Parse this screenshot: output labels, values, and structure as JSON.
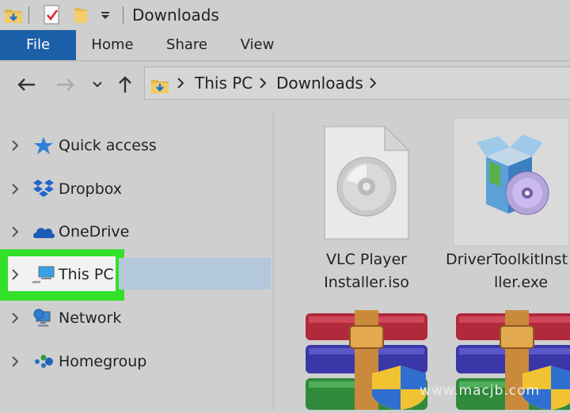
{
  "window": {
    "title": "Downloads"
  },
  "ribbon": {
    "tabs": [
      {
        "label": "File",
        "active": true
      },
      {
        "label": "Home"
      },
      {
        "label": "Share"
      },
      {
        "label": "View"
      }
    ]
  },
  "address_bar": {
    "path": [
      "This PC",
      "Downloads"
    ]
  },
  "sidebar": {
    "items": [
      {
        "label": "Quick access",
        "icon": "star-icon"
      },
      {
        "label": "Dropbox",
        "icon": "dropbox-icon"
      },
      {
        "label": "OneDrive",
        "icon": "cloud-icon"
      },
      {
        "label": "This PC",
        "icon": "computer-icon",
        "selected": true
      },
      {
        "label": "Network",
        "icon": "network-icon"
      },
      {
        "label": "Homegroup",
        "icon": "homegroup-icon"
      }
    ]
  },
  "files": [
    {
      "line1": "VLC Player",
      "line2": "Installer.iso",
      "icon": "disc-image-icon"
    },
    {
      "line1": "DriverToolkitInst",
      "line2": "ller.exe",
      "icon": "installer-icon"
    },
    {
      "line1": "",
      "line2": "",
      "icon": "winrar-icon"
    },
    {
      "line1": "",
      "line2": "",
      "icon": "winrar-icon"
    }
  ],
  "watermark": "www.macjb.com",
  "colors": {
    "file_tab": "#1a5fa8",
    "selection": "#b4c8dc",
    "highlight": "#33e12a"
  }
}
